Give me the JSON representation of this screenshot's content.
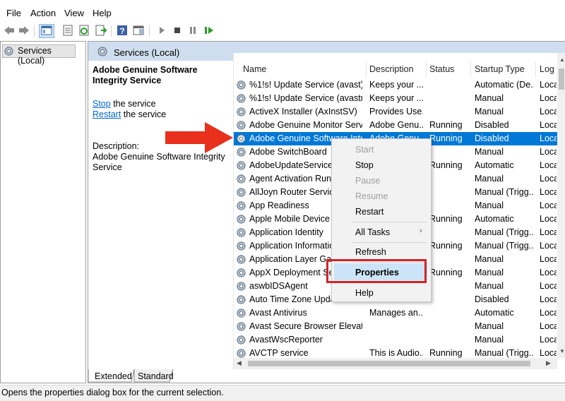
{
  "menu": {
    "file": "File",
    "action": "Action",
    "view": "View",
    "help": "Help"
  },
  "left_tree": {
    "root_label": "Services (Local)"
  },
  "header": {
    "title": "Services (Local)"
  },
  "details": {
    "service_name": "Adobe Genuine Software Integrity Service",
    "stop_link": "Stop",
    "stop_suffix": " the service",
    "restart_link": "Restart",
    "restart_suffix": " the service",
    "description_label": "Description:",
    "description_text": "Adobe Genuine Software Integrity Service"
  },
  "columns": {
    "name": "Name",
    "description": "Description",
    "status": "Status",
    "startup": "Startup Type",
    "logon": "Log"
  },
  "rows": [
    {
      "name": "%1!s! Update Service (avast)",
      "desc": "Keeps your ...",
      "status": "",
      "startup": "Automatic (De...",
      "logon": "Loca"
    },
    {
      "name": "%1!s! Update Service (avastm)",
      "desc": "Keeps your ...",
      "status": "",
      "startup": "Manual",
      "logon": "Loca"
    },
    {
      "name": "ActiveX Installer (AxInstSV)",
      "desc": "Provides Use...",
      "status": "",
      "startup": "Manual",
      "logon": "Loca"
    },
    {
      "name": "Adobe Genuine Monitor Serv...",
      "desc": "Adobe Genu...",
      "status": "Running",
      "startup": "Disabled",
      "logon": "Loca"
    },
    {
      "name": "Adobe Genuine Software Inte...",
      "desc": "Adobe Genu...",
      "status": "Running",
      "startup": "Disabled",
      "logon": "Loca"
    },
    {
      "name": "Adobe SwitchBoard",
      "desc": "",
      "status": "",
      "startup": "Manual",
      "logon": "Loca"
    },
    {
      "name": "AdobeUpdateService",
      "desc": "",
      "status": "Running",
      "startup": "Automatic",
      "logon": "Loca"
    },
    {
      "name": "Agent Activation Runt",
      "desc": "",
      "status": "",
      "startup": "Manual",
      "logon": "Loca"
    },
    {
      "name": "AllJoyn Router Service",
      "desc": "",
      "status": "",
      "startup": "Manual (Trigg...",
      "logon": "Loca"
    },
    {
      "name": "App Readiness",
      "desc": "",
      "status": "",
      "startup": "Manual",
      "logon": "Loca"
    },
    {
      "name": "Apple Mobile Device S",
      "desc": "",
      "status": "Running",
      "startup": "Automatic",
      "logon": "Loca"
    },
    {
      "name": "Application Identity",
      "desc": "",
      "status": "",
      "startup": "Manual (Trigg...",
      "logon": "Loca"
    },
    {
      "name": "Application Informatio",
      "desc": "",
      "status": "Running",
      "startup": "Manual (Trigg...",
      "logon": "Loca"
    },
    {
      "name": "Application Layer Gat",
      "desc": "",
      "status": "",
      "startup": "Manual",
      "logon": "Loca"
    },
    {
      "name": "AppX Deployment Se",
      "desc": "",
      "status": "Running",
      "startup": "Manual",
      "logon": "Loca"
    },
    {
      "name": "aswbIDSAgent",
      "desc": "",
      "status": "",
      "startup": "Manual",
      "logon": "Loca"
    },
    {
      "name": "Auto Time Zone Upda",
      "desc": "",
      "status": "",
      "startup": "Disabled",
      "logon": "Loca"
    },
    {
      "name": "Avast Antivirus",
      "desc": "Manages an...",
      "status": "",
      "startup": "Automatic",
      "logon": "Loca"
    },
    {
      "name": "Avast Secure Browser Elevati...",
      "desc": "",
      "status": "",
      "startup": "Manual",
      "logon": "Loca"
    },
    {
      "name": "AvastWscReporter",
      "desc": "",
      "status": "",
      "startup": "Manual",
      "logon": "Loca"
    },
    {
      "name": "AVCTP service",
      "desc": "This is Audio...",
      "status": "Running",
      "startup": "Manual (Trigg...",
      "logon": "Loca"
    }
  ],
  "context_menu": {
    "start": "Start",
    "stop": "Stop",
    "pause": "Pause",
    "resume": "Resume",
    "restart": "Restart",
    "all_tasks": "All Tasks",
    "refresh": "Refresh",
    "properties": "Properties",
    "help": "Help"
  },
  "tabs": {
    "extended": "Extended",
    "standard": "Standard"
  },
  "status_bar": {
    "text": "Opens the properties dialog box for the current selection."
  },
  "colors": {
    "selection": "#0078d7",
    "header_bg": "#cfdeee",
    "highlight_box": "#d2232a",
    "arrow": "#e8301c"
  },
  "icons": [
    "back-icon",
    "forward-icon",
    "console-tree-icon",
    "properties-icon",
    "refresh-icon",
    "export-icon",
    "help-icon",
    "show-hide-icon",
    "play-icon",
    "stop-icon",
    "pause-icon",
    "resume-icon",
    "gear-icon"
  ]
}
